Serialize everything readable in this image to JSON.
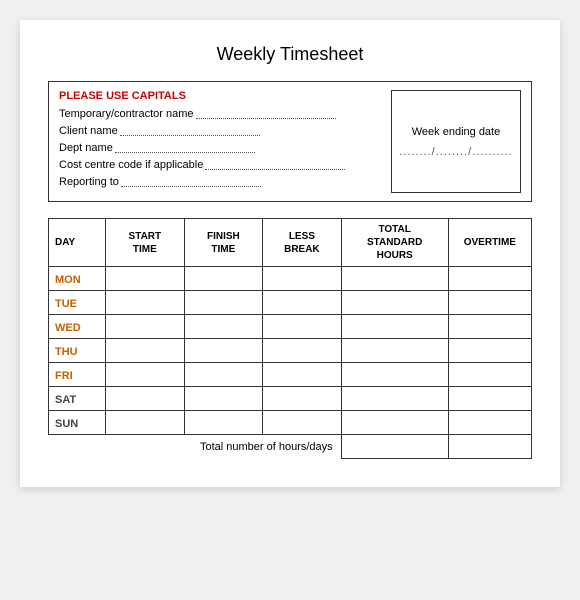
{
  "page": {
    "title": "Weekly Timesheet",
    "info_box": {
      "header": "PLEASE USE CAPITALS",
      "fields": [
        {
          "label": "Temporary/contractor name"
        },
        {
          "label": "Client name"
        },
        {
          "label": "Dept name"
        },
        {
          "label": "Cost centre code if applicable"
        },
        {
          "label": "Reporting to"
        }
      ],
      "week_ending_label": "Week ending date",
      "week_ending_value": "......../......../.........."
    },
    "table": {
      "headers": [
        {
          "key": "day",
          "label": "DAY"
        },
        {
          "key": "start",
          "label": "START\nTIME"
        },
        {
          "key": "finish",
          "label": "FINISH\nTIME"
        },
        {
          "key": "break",
          "label": "LESS\nBREAK"
        },
        {
          "key": "total",
          "label": "TOTAL\nSTANDARD\nHOURS"
        },
        {
          "key": "ot",
          "label": "OVERTIME"
        }
      ],
      "days": [
        {
          "label": "MON",
          "style": "orange"
        },
        {
          "label": "TUE",
          "style": "orange"
        },
        {
          "label": "WED",
          "style": "orange"
        },
        {
          "label": "THU",
          "style": "orange"
        },
        {
          "label": "FRI",
          "style": "orange"
        },
        {
          "label": "SAT",
          "style": "dark"
        },
        {
          "label": "SUN",
          "style": "dark"
        }
      ],
      "total_row_label": "Total number of hours/days"
    }
  }
}
